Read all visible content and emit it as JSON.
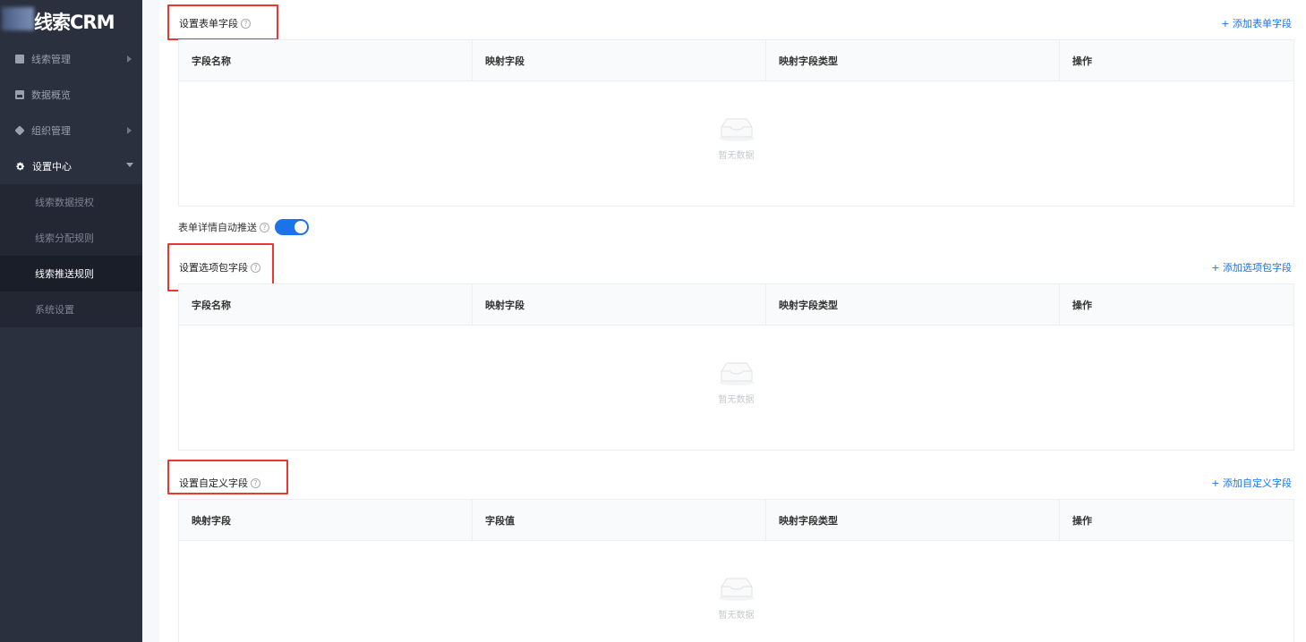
{
  "app": {
    "logo_text": "线索CRM"
  },
  "sidebar": {
    "items": [
      {
        "label": "线索管理",
        "icon": "book-icon"
      },
      {
        "label": "数据概览",
        "icon": "chart-icon"
      },
      {
        "label": "组织管理",
        "icon": "cube-icon"
      },
      {
        "label": "设置中心",
        "icon": "gear-icon"
      }
    ],
    "subitems": [
      {
        "label": "线索数据授权"
      },
      {
        "label": "线索分配规则"
      },
      {
        "label": "线索推送规则"
      },
      {
        "label": "系统设置"
      }
    ]
  },
  "form_fields": {
    "title": "设置表单字段",
    "add_label": "+ 添加表单字段",
    "columns": [
      "字段名称",
      "映射字段",
      "映射字段类型",
      "操作"
    ],
    "empty_text": "暂无数据"
  },
  "auto_push": {
    "label": "表单详情自动推送",
    "enabled": true
  },
  "option_fields": {
    "title": "设置选项包字段",
    "add_label": "+ 添加选项包字段",
    "columns": [
      "字段名称",
      "映射字段",
      "映射字段类型",
      "操作"
    ],
    "empty_text": "暂无数据"
  },
  "custom_fields": {
    "title": "设置自定义字段",
    "add_label": "+ 添加自定义字段",
    "columns": [
      "映射字段",
      "字段值",
      "映射字段类型",
      "操作"
    ],
    "empty_text": "暂无数据"
  },
  "colors": {
    "accent": "#1a73e8",
    "sidebar_bg": "#2a303d",
    "highlight": "#e8382f"
  }
}
